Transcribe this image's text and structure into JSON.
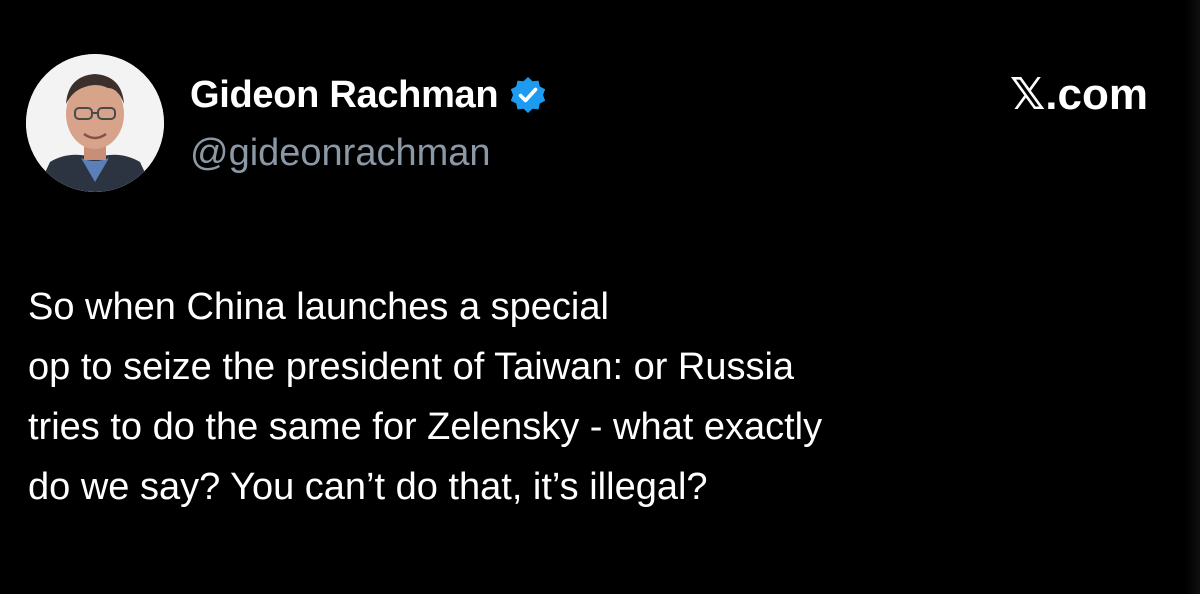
{
  "tweet": {
    "author": {
      "display_name": "Gideon Rachman",
      "handle": "@gideonrachman",
      "avatar_icon": "profile-photo",
      "verified_icon": "verified-badge-icon"
    },
    "source_mark": "𝕏.com",
    "text_lines": [
      "So when China launches a special",
      "op to seize the president of Taiwan: or Russia",
      "tries to do the same for Zelensky - what exactly",
      "do we say? You can’t do that, it’s illegal?"
    ]
  },
  "colors": {
    "background": "#000000",
    "text": "#ffffff",
    "handle": "#8b98a5",
    "verified_badge": "#1d9bf0"
  }
}
